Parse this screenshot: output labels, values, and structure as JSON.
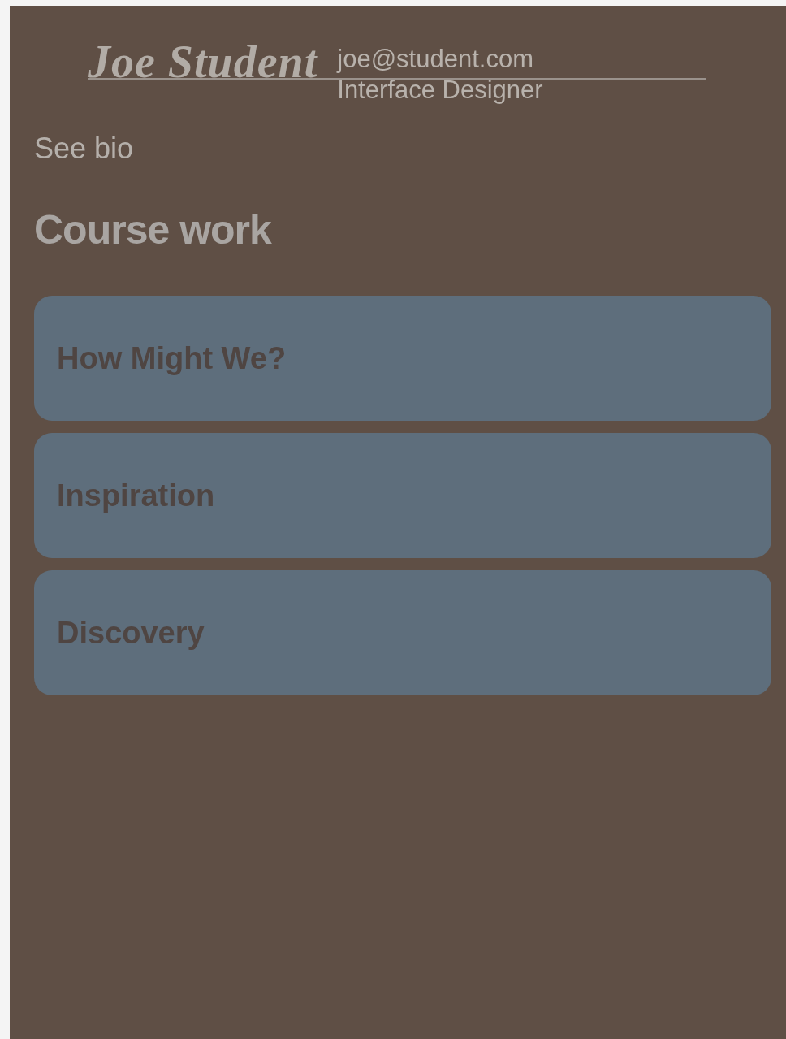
{
  "header": {
    "name": "Joe Student",
    "email": "joe@student.com",
    "role": "Interface Designer"
  },
  "bio_link": "See bio",
  "section_title": "Course work",
  "cards": [
    {
      "label": "How Might We?"
    },
    {
      "label": "Inspiration"
    },
    {
      "label": "Discovery"
    }
  ]
}
